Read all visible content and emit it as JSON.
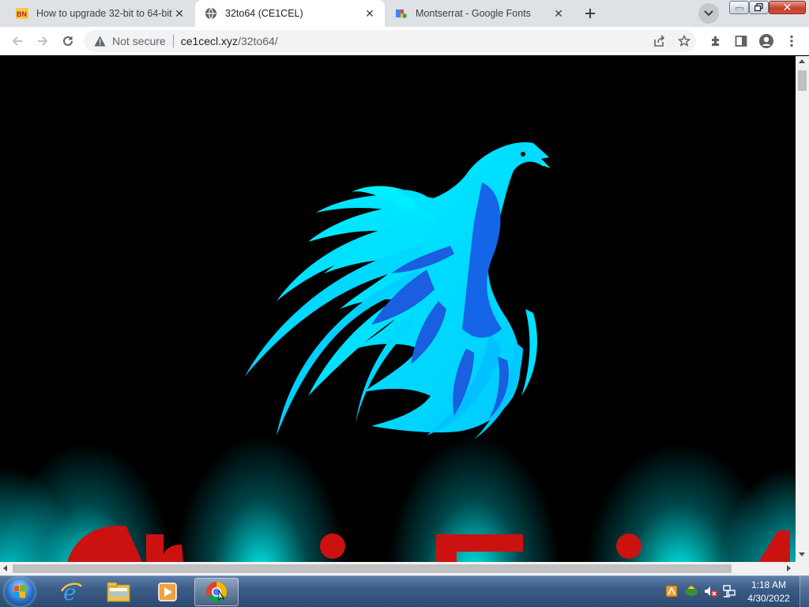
{
  "browser": {
    "tabs": [
      {
        "title": "How to upgrade 32-bit to 64-bit",
        "active": false,
        "favicon": "bn-favicon"
      },
      {
        "title": "32to64 (CE1CEL)",
        "active": true,
        "favicon": "globe-icon"
      },
      {
        "title": "Montserrat - Google Fonts",
        "active": false,
        "favicon": "google-fonts-icon"
      }
    ],
    "omnibox": {
      "security_label": "Not secure",
      "url_host": "ce1cecl.xyz",
      "url_path": "/32to64/"
    }
  },
  "page": {
    "background_color": "#000000",
    "logo": "phoenix-logo",
    "accent_color": "#00e5f0",
    "heading_color": "#cc1111"
  },
  "taskbar": {
    "time": "1:18 AM",
    "date": "4/30/2022",
    "pinned": [
      "internet-explorer-icon",
      "windows-explorer-icon",
      "media-player-icon",
      "chrome-icon"
    ]
  }
}
